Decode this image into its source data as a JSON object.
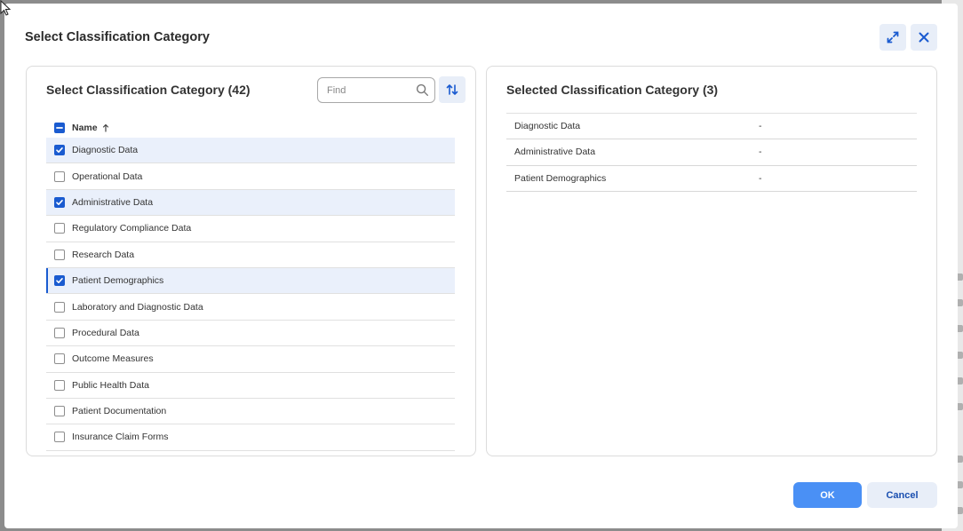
{
  "dialog": {
    "title": "Select Classification Category",
    "expand_icon": "expand-icon",
    "close_icon": "close-icon"
  },
  "left_panel": {
    "heading": "Select Classification Category (42)",
    "search": {
      "placeholder": "Find",
      "value": ""
    },
    "column_header": "Name",
    "sort_direction": "ascending",
    "items": [
      {
        "label": "Diagnostic Data",
        "checked": true
      },
      {
        "label": "Operational Data",
        "checked": false
      },
      {
        "label": "Administrative Data",
        "checked": true
      },
      {
        "label": "Regulatory Compliance Data",
        "checked": false
      },
      {
        "label": "Research Data",
        "checked": false
      },
      {
        "label": "Patient Demographics",
        "checked": true
      },
      {
        "label": "Laboratory and Diagnostic Data",
        "checked": false
      },
      {
        "label": "Procedural Data",
        "checked": false
      },
      {
        "label": "Outcome Measures",
        "checked": false
      },
      {
        "label": "Public Health Data",
        "checked": false
      },
      {
        "label": "Patient Documentation",
        "checked": false
      },
      {
        "label": "Insurance Claim Forms",
        "checked": false
      }
    ]
  },
  "right_panel": {
    "heading": "Selected Classification Category (3)",
    "items": [
      {
        "name": "Diagnostic Data",
        "value": "-"
      },
      {
        "name": "Administrative Data",
        "value": "-"
      },
      {
        "name": "Patient Demographics",
        "value": "-"
      }
    ]
  },
  "footer": {
    "ok_label": "OK",
    "cancel_label": "Cancel"
  },
  "colors": {
    "accent": "#1a5bd0",
    "primary_button": "#4a90f5",
    "selected_row": "#eaf0fb"
  }
}
